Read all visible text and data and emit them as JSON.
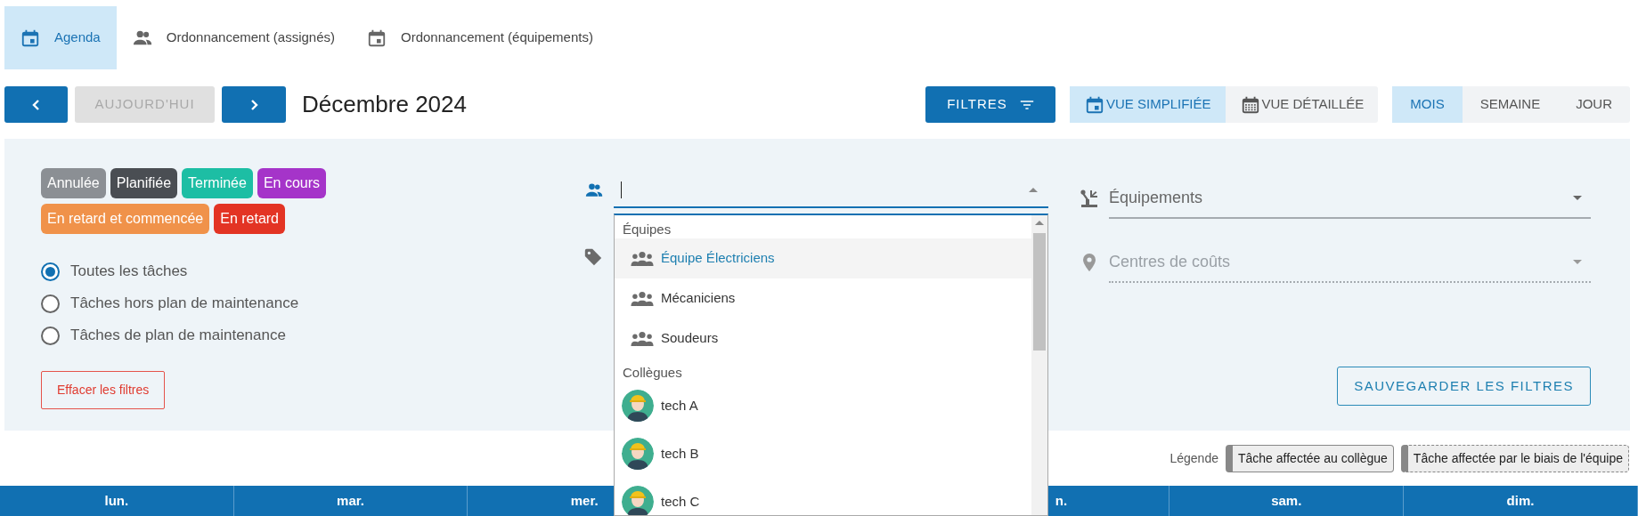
{
  "tabs": [
    {
      "label": "Agenda",
      "kind": "calendar",
      "selected": true
    },
    {
      "label": "Ordonnancement (assignés)",
      "kind": "people",
      "selected": false
    },
    {
      "label": "Ordonnancement (équipements)",
      "kind": "calendar",
      "selected": false
    }
  ],
  "toolbar": {
    "today_button": {
      "label": "AUJOURD'HUI",
      "disabled": true
    },
    "period_title": "Décembre 2024",
    "filters_button": "FILTRES",
    "view_modes": [
      {
        "label": "VUE SIMPLIFIÉE",
        "selected": true
      },
      {
        "label": "VUE DÉTAILLÉE",
        "selected": false
      }
    ],
    "ranges": [
      {
        "label": "MOIS",
        "selected": true
      },
      {
        "label": "SEMAINE",
        "selected": false
      },
      {
        "label": "JOUR",
        "selected": false
      }
    ]
  },
  "filters": {
    "statuses": [
      {
        "label": "Annulée",
        "color": "#8b8f94"
      },
      {
        "label": "Planifiée",
        "color": "#4a4e53"
      },
      {
        "label": "Terminée",
        "color": "#1dbea4"
      },
      {
        "label": "En cours",
        "color": "#a534c9"
      },
      {
        "label": "En retard et commencée",
        "color": "#f0924a"
      },
      {
        "label": "En retard",
        "color": "#e33424"
      }
    ],
    "task_types": [
      {
        "label": "Toutes les tâches",
        "selected": true
      },
      {
        "label": "Tâches hors plan de maintenance",
        "selected": false
      },
      {
        "label": "Tâches de plan de maintenance",
        "selected": false
      }
    ],
    "clear_button": "Effacer les filtres",
    "assignee_field": {
      "expanded": true
    },
    "equipment_field": {
      "placeholder": "Équipements",
      "disabled": false
    },
    "cost_center_field": {
      "placeholder": "Centres de coûts",
      "disabled": true
    },
    "save_button": "SAUVEGARDER LES FILTRES"
  },
  "dropdown": {
    "groups": [
      {
        "label": "Équipes",
        "options": [
          {
            "label": "Équipe Électriciens",
            "kind": "team",
            "highlighted": true
          },
          {
            "label": "Mécaniciens",
            "kind": "team",
            "highlighted": false
          },
          {
            "label": "Soudeurs",
            "kind": "team",
            "highlighted": false
          }
        ]
      },
      {
        "label": "Collègues",
        "options": [
          {
            "label": "tech A",
            "kind": "colleague",
            "highlighted": false
          },
          {
            "label": "tech B",
            "kind": "colleague",
            "highlighted": false
          },
          {
            "label": "tech C",
            "kind": "colleague",
            "highlighted": false
          }
        ]
      }
    ]
  },
  "legend": {
    "label": "Légende",
    "items": [
      {
        "label": "Tâche affectée au collègue",
        "kind": "colleague"
      },
      {
        "label": "Tâche affectée par le biais de l'équipe",
        "kind": "team"
      }
    ]
  },
  "calendar": {
    "columns": [
      {
        "label": "lun."
      },
      {
        "label": "mar."
      },
      {
        "label": "mer."
      },
      {},
      {
        "label": "n.",
        "partial": true
      },
      {
        "label": "sam."
      },
      {
        "label": "dim."
      }
    ]
  }
}
